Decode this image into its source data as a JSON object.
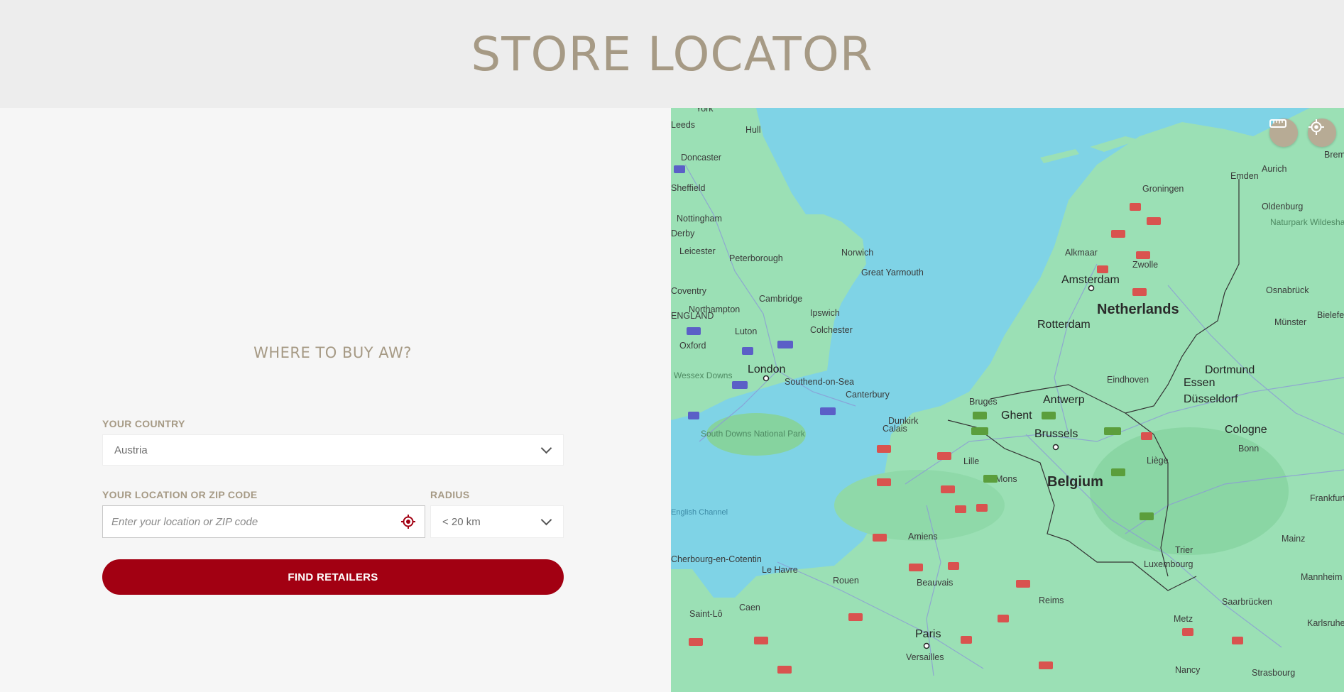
{
  "header": {
    "title": "STORE LOCATOR"
  },
  "form": {
    "heading": "WHERE TO BUY AW?",
    "country_label": "YOUR COUNTRY",
    "country_value": "Austria",
    "location_label": "YOUR LOCATION OR ZIP CODE",
    "location_placeholder": "Enter your location or ZIP code",
    "location_value": "",
    "radius_label": "RADIUS",
    "radius_value": "< 20 km",
    "submit_label": "FIND RETAILERS"
  },
  "map": {
    "countries": [
      "Netherlands",
      "Belgium"
    ],
    "major_cities": [
      "London",
      "Amsterdam",
      "Rotterdam",
      "Brussels",
      "Antwerp",
      "Ghent",
      "Paris",
      "Dortmund",
      "Düsseldorf",
      "Cologne",
      "Essen",
      "Luxembourg"
    ],
    "cities": [
      "York",
      "Hull",
      "Leeds",
      "Doncaster",
      "Sheffield",
      "Nottingham",
      "Derby",
      "Leicester",
      "Peterborough",
      "Norwich",
      "Great Yarmouth",
      "Cambridge",
      "Northampton",
      "Coventry",
      "Ipswich",
      "Colchester",
      "Luton",
      "Oxford",
      "Southend-on-Sea",
      "Canterbury",
      "Dunkirk",
      "Calais",
      "Bruges",
      "Lille",
      "Mons",
      "Liège",
      "Eindhoven",
      "Groningen",
      "Emden",
      "Aurich",
      "Oldenburg",
      "Bremerhaven",
      "Zwolle",
      "Alkmaar",
      "Osnabrück",
      "Münster",
      "Bielefeld",
      "Bonn",
      "Frankfurt am Main",
      "Mainz",
      "Mannheim",
      "Karlsruhe",
      "Trier",
      "Saarbrücken",
      "Metz",
      "Nancy",
      "Strasbourg",
      "Reims",
      "Amiens",
      "Beauvais",
      "Rouen",
      "Le Havre",
      "Caen",
      "Saint-Lô",
      "Versailles",
      "Cherbourg-en-Cotentin"
    ],
    "parks": [
      "Naturpark Wildeshauser Geest",
      "South Downs National Park",
      "Wessex Downs"
    ],
    "water": [
      "English Channel"
    ],
    "region_labels": [
      "ENGLAND"
    ],
    "buttons": {
      "measure": "ruler-icon",
      "locate": "crosshair-icon"
    },
    "colors": {
      "water": "#7fd3e6",
      "land": "#9be0b5",
      "accent": "#a20012",
      "title": "#a69a85"
    }
  }
}
